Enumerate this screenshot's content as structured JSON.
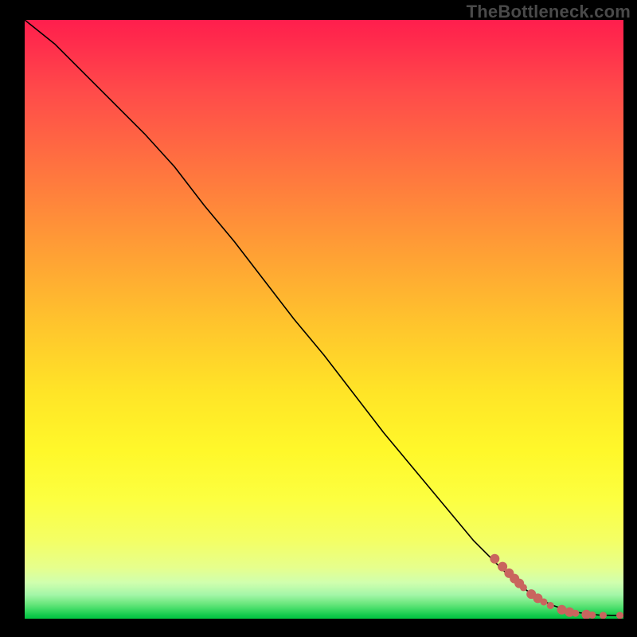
{
  "watermark": "TheBottleneck.com",
  "chart_data": {
    "type": "line",
    "title": "",
    "xlabel": "",
    "ylabel": "",
    "xlim": [
      0,
      100
    ],
    "ylim": [
      0,
      100
    ],
    "grid": false,
    "legend": false,
    "series": [
      {
        "name": "curve",
        "x": [
          0,
          5,
          10,
          15,
          20,
          25,
          30,
          35,
          40,
          45,
          50,
          55,
          60,
          65,
          70,
          75,
          80,
          82,
          84,
          86,
          88,
          90,
          92,
          94,
          96,
          98,
          100
        ],
        "y": [
          100,
          96,
          91,
          86,
          81,
          75.5,
          69,
          63,
          56.5,
          50,
          44,
          37.5,
          31,
          25,
          19,
          13,
          8,
          6.2,
          4.6,
          3.3,
          2.3,
          1.6,
          1.1,
          0.8,
          0.6,
          0.55,
          0.55
        ]
      }
    ],
    "markers": {
      "name": "data-points",
      "color": "#c9655e",
      "points": [
        {
          "x": 78.5,
          "y": 10.0,
          "r": 6
        },
        {
          "x": 79.8,
          "y": 8.7,
          "r": 6
        },
        {
          "x": 80.9,
          "y": 7.6,
          "r": 6
        },
        {
          "x": 81.8,
          "y": 6.7,
          "r": 6
        },
        {
          "x": 82.6,
          "y": 5.9,
          "r": 6
        },
        {
          "x": 83.3,
          "y": 5.2,
          "r": 4.5
        },
        {
          "x": 84.6,
          "y": 4.1,
          "r": 6
        },
        {
          "x": 85.7,
          "y": 3.4,
          "r": 6
        },
        {
          "x": 86.7,
          "y": 2.8,
          "r": 4.5
        },
        {
          "x": 87.8,
          "y": 2.2,
          "r": 4.5
        },
        {
          "x": 89.7,
          "y": 1.5,
          "r": 6
        },
        {
          "x": 91.0,
          "y": 1.1,
          "r": 6
        },
        {
          "x": 92.0,
          "y": 0.9,
          "r": 4.5
        },
        {
          "x": 93.8,
          "y": 0.7,
          "r": 6
        },
        {
          "x": 94.8,
          "y": 0.6,
          "r": 4.5
        },
        {
          "x": 96.6,
          "y": 0.55,
          "r": 4.5
        },
        {
          "x": 99.4,
          "y": 0.55,
          "r": 4.5
        }
      ]
    }
  }
}
